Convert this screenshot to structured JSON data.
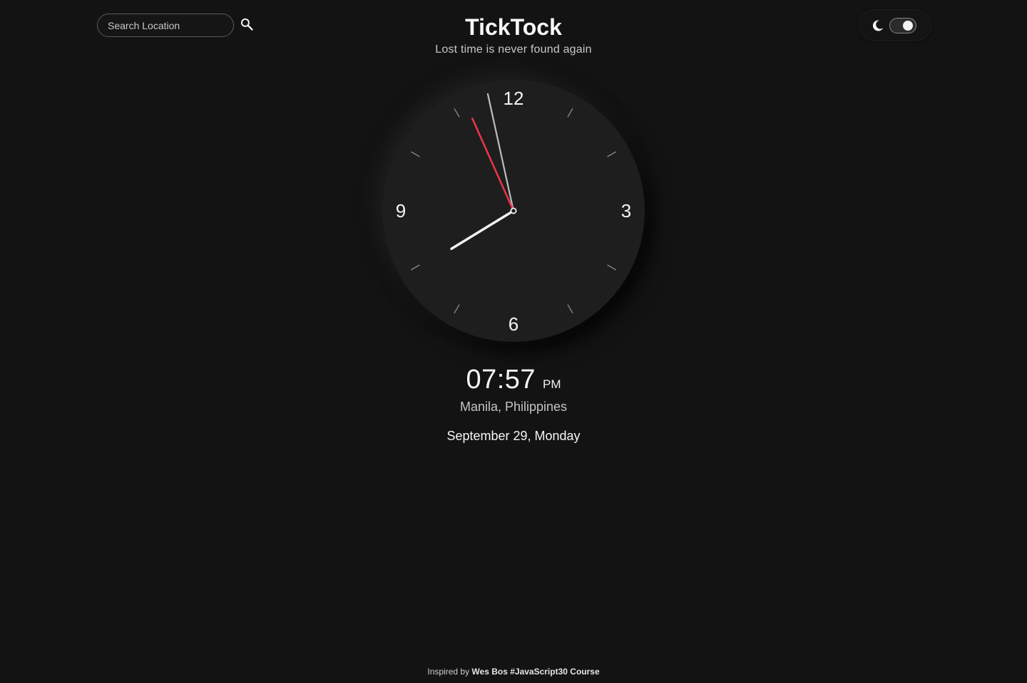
{
  "search": {
    "placeholder": "Search Location",
    "value": "",
    "button_icon": "search-icon"
  },
  "header": {
    "title": "TickTock",
    "tagline": "Lost time is never found again"
  },
  "theme_toggle": {
    "icon": "moon-icon",
    "mode": "dark",
    "enabled": true
  },
  "clock": {
    "numerals": {
      "twelve": "12",
      "three": "3",
      "six": "6",
      "nine": "9"
    },
    "hours": 19,
    "minutes": 57,
    "seconds": 56,
    "colors": {
      "face": "#1e1e1e",
      "second_hand": "#e8344a",
      "minute_hand": "#bdbdbd",
      "hour_hand": "#f2f2f2"
    }
  },
  "digital": {
    "time": "07:57",
    "ampm": "PM",
    "location": "Manila, Philippines",
    "date": "September 29, Monday"
  },
  "footer": {
    "prefix": "Inspired by",
    "credit": "Wes Bos #JavaScript30 Course"
  },
  "colors": {
    "background": "#131313",
    "text": "#f2f2f2",
    "muted_text": "#c4c4c4"
  }
}
